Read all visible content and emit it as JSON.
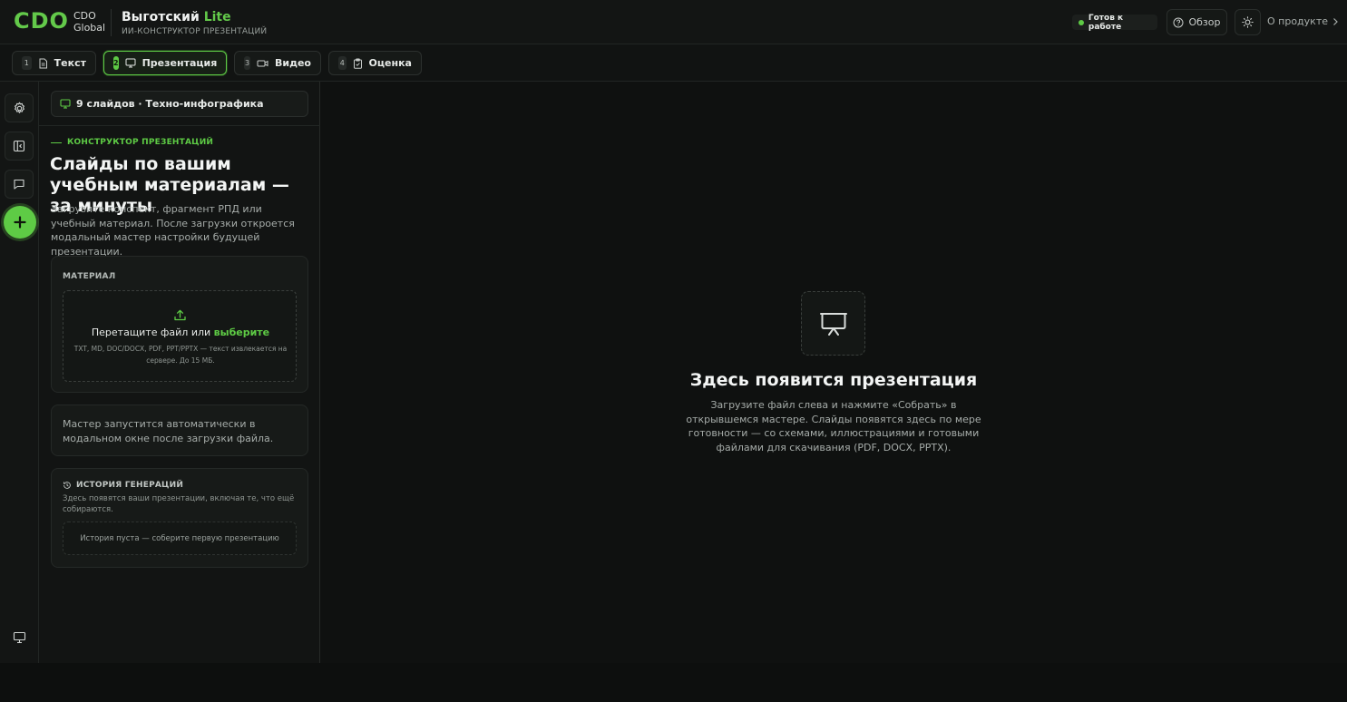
{
  "header": {
    "logo": "CDO",
    "logo_sub_line1": "CDO",
    "logo_sub_line2": "Global",
    "brand_name": "Выготский",
    "brand_suffix": "Lite",
    "brand_subtitle": "ИИ-КОНСТРУКТОР ПРЕЗЕНТАЦИЙ",
    "status": "Готов к работе",
    "overview_label": "Обзор",
    "about_label": "О продукте"
  },
  "tabs": [
    {
      "num": "1",
      "label": "Текст",
      "icon": "document-icon"
    },
    {
      "num": "2",
      "label": "Презентация",
      "icon": "presentation-icon",
      "active": true
    },
    {
      "num": "3",
      "label": "Видео",
      "icon": "video-icon"
    },
    {
      "num": "4",
      "label": "Оценка",
      "icon": "clipboard-icon"
    }
  ],
  "rail": {
    "items": [
      "settings-icon",
      "sidebar-panel-icon",
      "chat-icon",
      "plus-icon",
      "presentation-icon"
    ]
  },
  "panel": {
    "summary": "9 слайдов · Техно-инфографика",
    "eyebrow": "КОНСТРУКТОР ПРЕЗЕНТАЦИЙ",
    "title": "Слайды по вашим учебным материалам — за минуты",
    "description": "Загрузите конспект, фрагмент РПД или учебный материал. После загрузки откроется модальный мастер настройки будущей презентации.",
    "material": {
      "label": "МАТЕРИАЛ",
      "drop_text": "Перетащите файл или",
      "drop_link": "выберите",
      "hint": "TXT, MD, DOC/DOCX, PDF, PPT/PPTX — текст извлекается на сервере. До 15 МБ."
    },
    "wizard_note": "Мастер запустится автоматически в модальном окне после загрузки файла.",
    "history": {
      "title": "ИСТОРИЯ ГЕНЕРАЦИЙ",
      "description": "Здесь появятся ваши презентации, включая те, что ещё собираются.",
      "empty": "История пуста — соберите первую презентацию"
    }
  },
  "main": {
    "title": "Здесь появится презентация",
    "description": "Загрузите файл слева и нажмите «Собрать» в открывшемся мастере. Слайды появятся здесь по мере готовности — со схемами, иллюстрациями и готовыми файлами для скачивания (PDF, DOCX, PPTX)."
  },
  "colors": {
    "accent": "#5ecb45",
    "background": "#0f1110",
    "panel": "#121413"
  }
}
